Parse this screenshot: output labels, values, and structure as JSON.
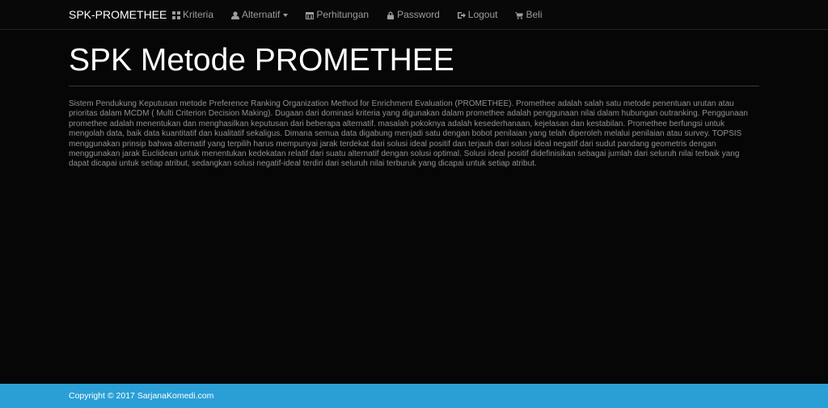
{
  "navbar": {
    "brand": "SPK-PROMETHEE",
    "items": [
      {
        "label": "Kriteria",
        "icon": "grid-icon"
      },
      {
        "label": "Alternatif",
        "icon": "user-icon",
        "has_dropdown": true
      },
      {
        "label": "Perhitungan",
        "icon": "calendar-icon"
      },
      {
        "label": "Password",
        "icon": "lock-icon"
      },
      {
        "label": "Logout",
        "icon": "logout-icon"
      },
      {
        "label": "Beli",
        "icon": "cart-icon"
      }
    ]
  },
  "main": {
    "title": "SPK Metode PROMETHEE",
    "description": "Sistem Pendukung Keputusan metode Preference Ranking Organization Method for Enrichment Evaluation (PROMETHEE). Promethee adalah salah satu metode penentuan urutan atau prioritas dalam MCDM ( Multi Criterion Decision Making). Dugaan dari dominasi kriteria yang digunakan dalam promethee adalah penggunaan nilai dalam hubungan outranking. Penggunaan promethee adalah menentukan dan menghasilkan keputusan dari beberapa alternatif. masalah pokoknya adalah kesederhanaan, kejelasan dan kestabilan. Promethee berfungsi untuk mengolah data, baik data kuantitatif dan kualitatif sekaligus. Dimana semua data digabung menjadi satu dengan bobot penilaian yang telah diperoleh melalui penilaian atau survey. TOPSIS menggunakan prinsip bahwa alternatif yang terpilih harus mempunyai jarak terdekat dari solusi ideal positif dan terjauh dari solusi ideal negatif dari sudut pandang geometris dengan menggunakan jarak Euclidean untuk menentukan kedekatan relatif dari suatu alternatif dengan solusi optimal. Solusi ideal positif didefinisikan sebagai jumlah dari seluruh nilai terbaik yang dapat dicapai untuk setiap atribut, sedangkan solusi negatif-ideal terdiri dari seluruh nilai terburuk yang dicapai untuk setiap atribut."
  },
  "footer": {
    "text": "Copyright © 2017 SarjanaKomedi.com"
  },
  "colors": {
    "background": "#060606",
    "navbar": "#080808",
    "footer": "#2a9fd6",
    "nav_text": "#9d9d9d"
  }
}
